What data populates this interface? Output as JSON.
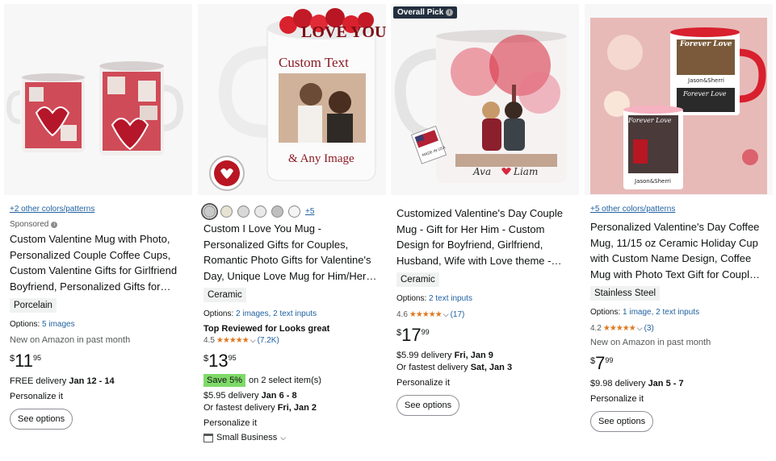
{
  "cards": [
    {
      "colors_link": "+2 other colors/patterns",
      "sponsored": "Sponsored",
      "title": "Custom Valentine Mug with Photo, Personalized Couple Coffee Cups, Custom Valentine Gifts for Girlfriend Boyfriend, Personalized Gifts for…",
      "tag": "Porcelain",
      "options_label": "Options:",
      "options_link": "5 images",
      "new_label": "New on Amazon in past month",
      "price_symbol": "$",
      "price_whole": "11",
      "price_fraction": "95",
      "delivery_text": "FREE delivery",
      "delivery_date": "Jan 12 - 14",
      "personalize": "Personalize it",
      "button": "See options"
    },
    {
      "more_swatches": "+5",
      "title": "Custom I Love You Mug - Personalized Gifts for Couples, Romantic Photo Gifts for Valentine's Day, Unique Love Mug for Him/Her…",
      "tag": "Ceramic",
      "options_label": "Options:",
      "options_link": "2 images, 2 text inputs",
      "top_reviewed": "Top Reviewed for Looks great",
      "rating": "4.5",
      "rating_count": "(7.2K)",
      "price_symbol": "$",
      "price_whole": "13",
      "price_fraction": "95",
      "save_badge": "Save 5%",
      "save_text": "on 2 select item(s)",
      "delivery_text": "$5.95 delivery",
      "delivery_date": "Jan 6 - 8",
      "fastest_text": "Or fastest delivery",
      "fastest_date": "Fri, Jan 2",
      "personalize": "Personalize it",
      "small_business": "Small Business",
      "image_text_1": "LOVE YOU",
      "image_text_2": "Custom Text",
      "image_text_3": "& Any Image"
    },
    {
      "badge": "Overall Pick",
      "title": "Customized Valentine's Day Couple Mug - Gift for Her Him - Custom Design for Boyfriend, Girlfriend, Husband, Wife with Love theme -…",
      "tag": "Ceramic",
      "options_label": "Options:",
      "options_link": "2 text inputs",
      "rating": "4.6",
      "rating_count": "(17)",
      "price_symbol": "$",
      "price_whole": "17",
      "price_fraction": "99",
      "delivery_text": "$5.99 delivery",
      "delivery_date": "Fri, Jan 9",
      "fastest_text": "Or fastest delivery",
      "fastest_date": "Sat, Jan 3",
      "personalize": "Personalize it",
      "button": "See options",
      "image_name_1": "Ava",
      "image_name_2": "Liam",
      "made_in": "MADE IN USA"
    },
    {
      "colors_link": "+5 other colors/patterns",
      "title": "Personalized Valentine's Day Coffee Mug, 11/15 oz Ceramic Holiday Cup with Custom Name Design, Coffee Mug with Photo Text Gift for Coupl…",
      "tag": "Stainless Steel",
      "options_label": "Options:",
      "options_link": "1 image, 2 text inputs",
      "rating": "4.2",
      "rating_count": "(3)",
      "new_label": "New on Amazon in past month",
      "price_symbol": "$",
      "price_whole": "7",
      "price_fraction": "99",
      "delivery_text": "$9.98 delivery",
      "delivery_date": "Jan 5 - 7",
      "personalize": "Personalize it",
      "button": "See options",
      "image_text_1": "Forever Love",
      "image_text_2": "Jason&Sherri",
      "image_text_3": "Forever Love",
      "image_text_4": "Jason&Sherri",
      "image_text_5": "Forever Love",
      "image_text_6": "Jason&Sherri"
    }
  ],
  "colors": {
    "link": "#2162a1",
    "star": "#de7921",
    "save_badge": "#7fda69",
    "badge_bg": "#232f3e"
  }
}
